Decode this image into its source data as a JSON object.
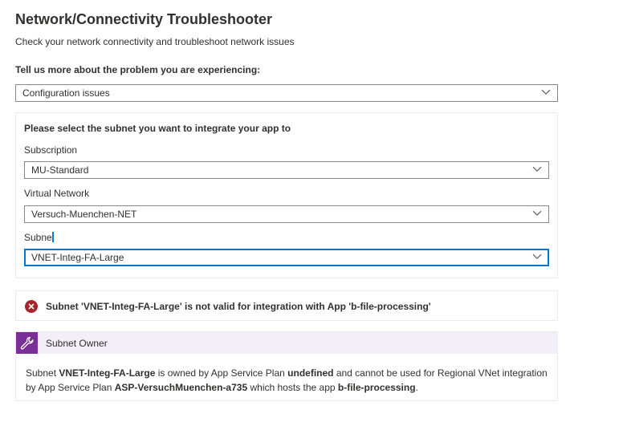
{
  "page": {
    "title": "Network/Connectivity Troubleshooter",
    "subtitle": "Check your network connectivity and troubleshoot network issues"
  },
  "problem": {
    "question": "Tell us more about the problem you are experiencing:",
    "selected": "Configuration issues"
  },
  "subnet_panel": {
    "heading": "Please select the subnet you want to integrate your app to",
    "subscription_label": "Subscription",
    "subscription_value": "MU-Standard",
    "vnet_label": "Virtual Network",
    "vnet_value": "Versuch-Muenchen-NET",
    "subnet_label": "Subne",
    "subnet_value": "VNET-Integ-FA-Large"
  },
  "error": {
    "message": "Subnet 'VNET-Integ-FA-Large' is not valid for integration with App 'b-file-processing'"
  },
  "owner": {
    "title": "Subnet Owner",
    "text_1": "Subnet ",
    "subnet": "VNET-Integ-FA-Large",
    "text_2": " is owned by App Service Plan ",
    "plan_owner": "undefined",
    "text_3": " and cannot be used for Regional VNet integration by App Service Plan ",
    "plan": "ASP-VersuchMuenchen-a735",
    "text_4": " which hosts the app ",
    "app": "b-file-processing",
    "text_5": "."
  },
  "icons": {
    "chevron": "chevron-down-icon",
    "error": "error-circle-icon",
    "owner": "wrench-icon"
  },
  "colors": {
    "accent": "#0078d4",
    "error": "#a4262c",
    "owner_icon_bg": "#7a2e98",
    "owner_header_bg": "#f3eef7"
  }
}
